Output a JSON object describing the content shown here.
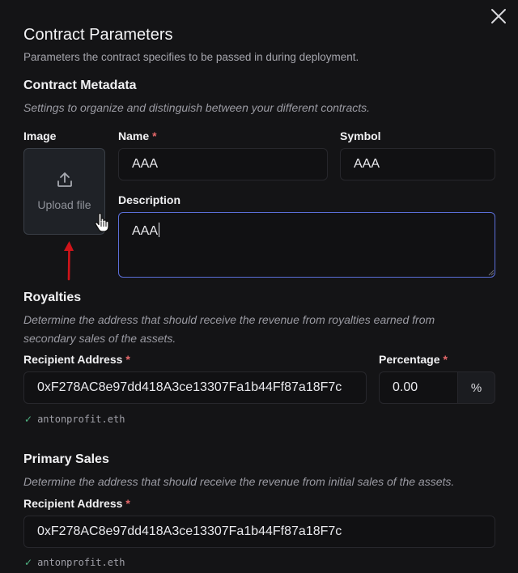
{
  "modal": {
    "title": "Contract Parameters",
    "subtitle": "Parameters the contract specifies to be passed in during deployment."
  },
  "metadata": {
    "heading": "Contract Metadata",
    "description": "Settings to organize and distinguish between your different contracts.",
    "image_label": "Image",
    "upload_label": "Upload file",
    "name_label": "Name",
    "name_value": "AAA",
    "symbol_label": "Symbol",
    "symbol_value": "AAA",
    "description_label": "Description",
    "description_value": "AAA",
    "required_marker": "*"
  },
  "royalties": {
    "heading": "Royalties",
    "description": "Determine the address that should receive the revenue from royalties earned from secondary sales of the assets.",
    "recipient_label": "Recipient Address",
    "recipient_value": "0xF278AC8e97dd418A3ce13307Fa1b44Ff87a18F7c",
    "percentage_label": "Percentage",
    "percentage_value": "0.00",
    "percentage_suffix": "%",
    "ens_name": "antonprofit.eth"
  },
  "primary_sales": {
    "heading": "Primary Sales",
    "description": "Determine the address that should receive the revenue from initial sales of the assets.",
    "recipient_label": "Recipient Address",
    "recipient_value": "0xF278AC8e97dd418A3ce13307Fa1b44Ff87a18F7c",
    "ens_name": "antonprofit.eth"
  },
  "colors": {
    "background": "#141416",
    "accent_border": "#5b6fd9",
    "required": "#e5686a",
    "success_check": "#4fb382",
    "annotation_arrow": "#d0141a"
  },
  "icons": [
    "close-icon",
    "upload-icon",
    "hand-cursor-icon",
    "check-icon",
    "arrow-up-annotation"
  ]
}
